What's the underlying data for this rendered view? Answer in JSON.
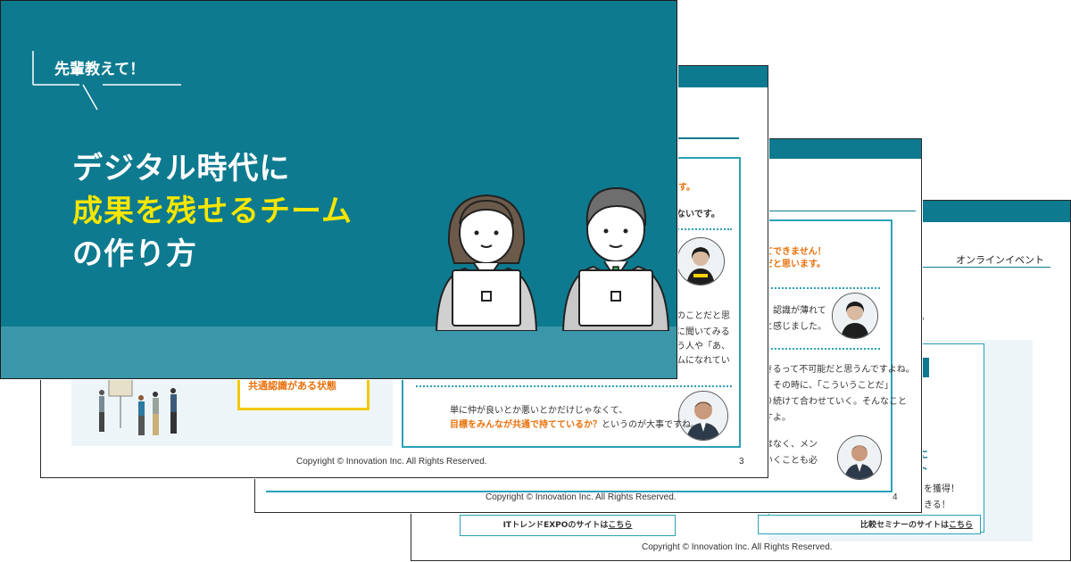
{
  "cover": {
    "bubble": "先輩教えて！",
    "title_line1": "デジタル時代に",
    "title_line2": "成果を残せるチーム",
    "title_line3": "の作り方"
  },
  "slide3": {
    "box_text": "共通認識がある状態",
    "chat_top1": "す。",
    "chat_top2": "ないです。",
    "chat_mid1": "のことだと思",
    "chat_mid2": "に聞いてみる",
    "chat_mid3": "う人や「あ、",
    "chat_mid4": "ムになれてい",
    "chat_bottom1": "単に仲が良いとか悪いとかだけじゃなくて、",
    "chat_bottom2_em": "目標をみんなが共通で持てているか？",
    "chat_bottom2_rest": "というのが大事ですね。",
    "copyright": "Copyright © Innovation Inc. All Rights Reserved.",
    "page": "3"
  },
  "slide4": {
    "em1": "てできません！",
    "em2": "だと思います。",
    "t1": "認識が薄れて",
    "t2": "と感じました。",
    "t3": "きるって不可能だと思うんですよね。",
    "t4": "、その時に、「こういうことだ」",
    "t5": "り続けて合わせていく。そんなこと",
    "t6": "すよ。",
    "t7": "はなく、メン",
    "t8": "いくことも必",
    "copyright": "Copyright © Innovation Inc. All Rights Reserved.",
    "page": "4"
  },
  "slide5": {
    "label": "オンラインイベント",
    "dot": "。",
    "t_ni": "に",
    "t_to": "ト",
    "t_get": "ドを獲得！",
    "t_can": "できる！",
    "link1_pre": "ITトレンドEXPOのサイトは",
    "link1_u": "こちら",
    "link2_pre": "比較セミナーのサイトは",
    "link2_u": "こちら",
    "copyright": "Copyright © Innovation Inc. All Rights Reserved."
  },
  "colors": {
    "teal": "#0e7a8f",
    "teal_light": "#3a97a9",
    "yellow": "#f5e600",
    "orange": "#e8700a",
    "accent_border": "#2aa0b8"
  }
}
